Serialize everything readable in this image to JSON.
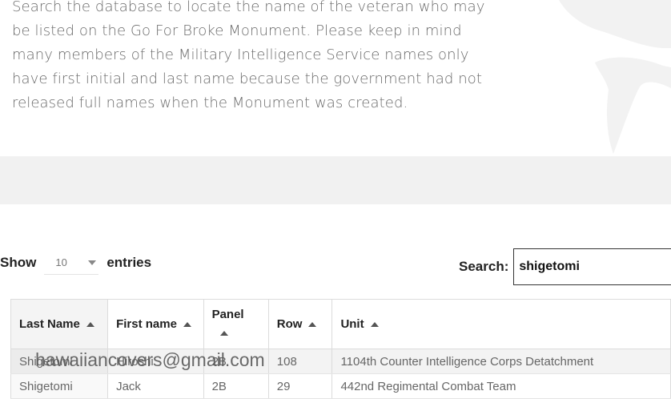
{
  "intro": {
    "lines": [
      "Search the database to locate the name of the veteran who may",
      "be listed on the Go For Broke Monument. Please keep in mind",
      "many members of the Military Intelligence Service names only",
      "have first initial and last name because the government had not",
      "released full names when the Monument was created."
    ]
  },
  "length": {
    "show_label": "Show",
    "value": "10",
    "entries_label": "entries"
  },
  "search": {
    "label": "Search:",
    "value": "shigetomi"
  },
  "table": {
    "headers": [
      "Last Name",
      "First name",
      "Panel",
      "Row",
      "Unit"
    ],
    "rows": [
      [
        "Shigetomi",
        "Hiroshi",
        "2B",
        "108",
        "1104th Counter Intelligence Corps Detatchment"
      ],
      [
        "Shigetomi",
        "Jack",
        "2B",
        "29",
        "442nd Regimental Combat Team"
      ]
    ]
  },
  "watermark": "hawaiiancovers@gmail.com",
  "colors": {
    "text": "#6b6b6b",
    "band": "#f1f1f1",
    "border": "#dcdcdc"
  }
}
